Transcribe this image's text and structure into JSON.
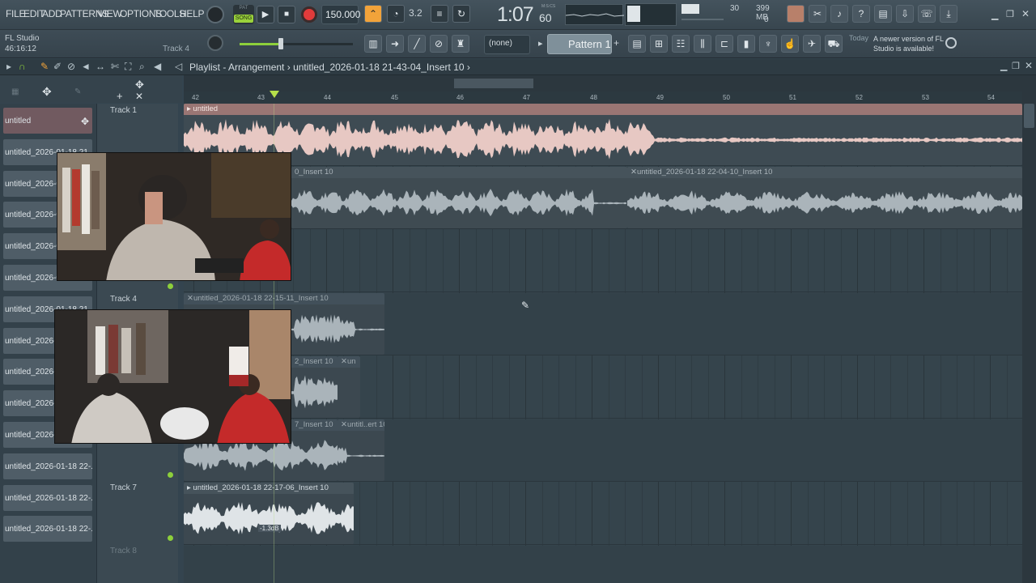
{
  "menu": [
    "FILE",
    "EDIT",
    "ADD",
    "PATTERNS",
    "VIEW",
    "OPTIONS",
    "TOOLS",
    "HELP"
  ],
  "transport": {
    "mode": "SONG",
    "pat_label": "PAT",
    "tempo": "150.000",
    "time_main": "1:07",
    "time_sub": "60",
    "time_unit": "M:S:CS",
    "cpu": "30",
    "mem": "399 MB",
    "poly": "0",
    "sig": "3.2"
  },
  "hint": {
    "title": "FL Studio",
    "time": "46:16:12",
    "track": "Track 4"
  },
  "pattern": {
    "none": "(none)",
    "name": "Pattern 1"
  },
  "news": {
    "label": "Today",
    "text": "A newer version of FL Studio is available!"
  },
  "playlist": {
    "title": "Playlist - Arrangement",
    "sep": "›",
    "crumb": "untitled_2026-01-18 21-43-04_Insert 10",
    "ruler": [
      "42",
      "43",
      "44",
      "45",
      "46",
      "47",
      "48",
      "49",
      "50",
      "51",
      "52",
      "53",
      "54"
    ]
  },
  "picker": [
    "untitled",
    "untitled_2026-01-18 21...",
    "untitled_2026-0",
    "untitled_2026-0",
    "untitled_2026-0",
    "untitled_2026-0",
    "untitled_2026-01-18 21...",
    "untitled_2026-0",
    "untitled_2026-0",
    "untitled_2026-0",
    "untitled_2026-0",
    "untitled_2026-01-18 22-...",
    "untitled_2026-01-18 22-...",
    "untitled_2026-01-18 22-..."
  ],
  "tracks": [
    "Track 1",
    "Track 4",
    "Track 7",
    "Track 8"
  ],
  "clips": {
    "c1": "untitled",
    "c2a": "0_Insert 10",
    "c2b": "untitled_2026-01-18 22-04-10_Insert 10",
    "c4": "untitled_2026-01-18 22-15-11_Insert 10",
    "c5a": "2_Insert 10",
    "c5b": "un",
    "c6a": "7_Insert 10",
    "c6b": "untitl..ert 10",
    "c7": "untitled_2026-01-18 22-17-06_Insert 10",
    "gain": "-1.3dB"
  },
  "colors": {
    "pink_clip": "#e7c8c3",
    "grey_clip": "#aab4ba",
    "accent_orange": "#f2a33a",
    "record_red": "#e23b3b",
    "track_green": "#8dcf3b"
  }
}
